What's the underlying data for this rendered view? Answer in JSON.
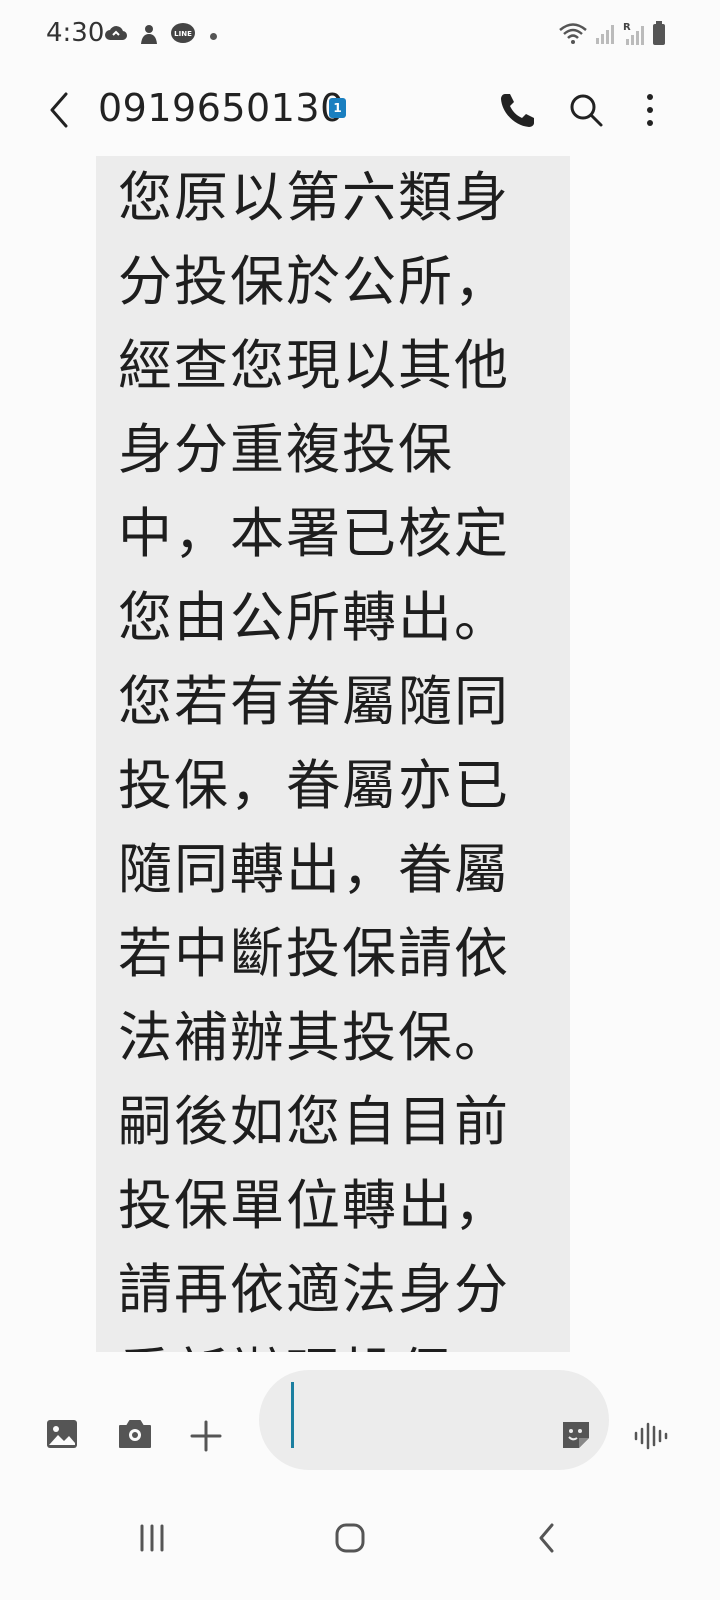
{
  "status_bar": {
    "time": "4:30",
    "left_icons": [
      "cloud-sync-icon",
      "notification-app-icon",
      "line-app-icon",
      "more-notifications-dot"
    ],
    "right_icons": [
      "wifi-icon",
      "signal-1-icon",
      "signal-roaming-icon",
      "battery-icon"
    ],
    "roaming_label": "R",
    "line_label": "LINE"
  },
  "header": {
    "title": "0919650130",
    "sim_badge": "1",
    "icons": [
      "back-icon",
      "call-icon",
      "search-icon",
      "more-options-icon"
    ]
  },
  "message": {
    "lines": [
      "您原以第六類身",
      "分投保於公所，",
      "經查您現以其他",
      "身分重複投保",
      "中，本署已核定",
      "您由公所轉出。",
      "您若有眷屬隨同",
      "投保，眷屬亦已",
      "隨同轉出，眷屬",
      "若中斷投保請依",
      "法補辦其投保。",
      "嗣後如您自目前",
      "投保單位轉出，",
      "請再依適法身分",
      "重新辦理投保。"
    ]
  },
  "composer": {
    "input_value": "",
    "icons": [
      "gallery-icon",
      "camera-icon",
      "add-icon",
      "sticker-icon",
      "voice-record-icon"
    ]
  },
  "navbar": {
    "icons": [
      "recents-icon",
      "home-icon",
      "nav-back-icon"
    ]
  },
  "colors": {
    "background": "#fbfbfb",
    "bubble": "#ececec",
    "sim_badge": "#1a7fc0",
    "cursor": "#1b7fa0"
  }
}
